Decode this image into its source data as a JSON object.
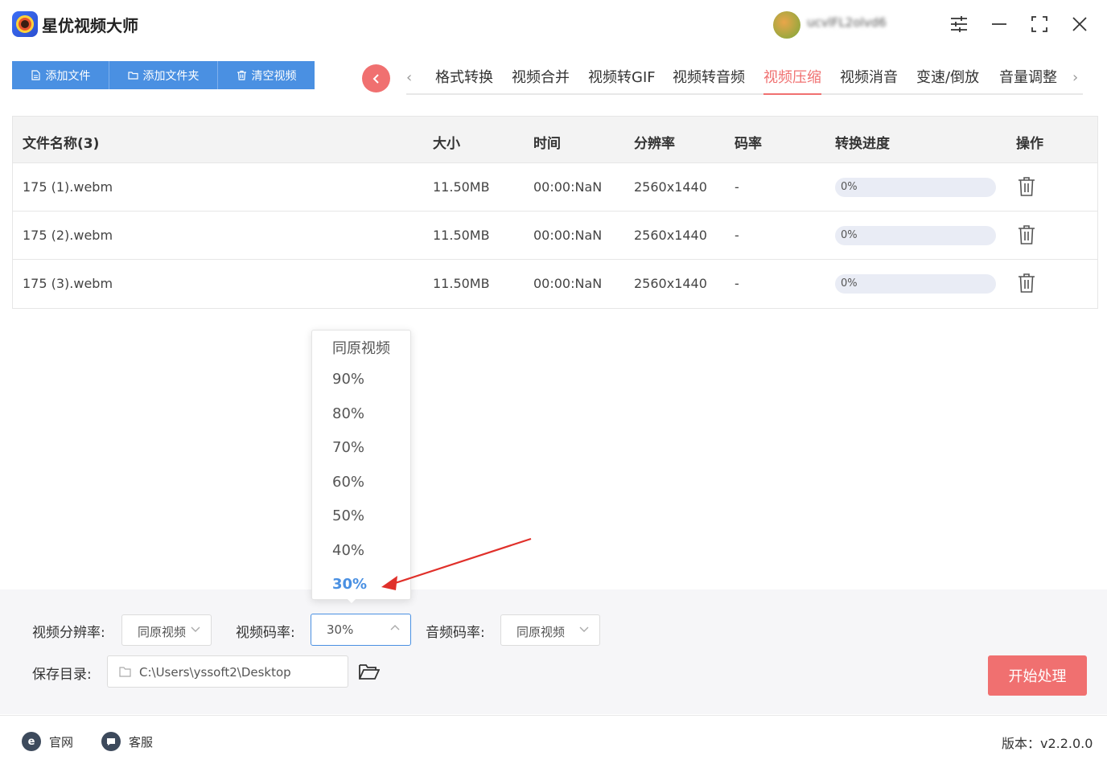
{
  "app": {
    "title": "星优视频大师"
  },
  "user": {
    "name": "ucvlFL2olvd6"
  },
  "toolbar": {
    "add_file": "添加文件",
    "add_folder": "添加文件夹",
    "clear": "清空视频"
  },
  "tabs": [
    "格式转换",
    "视频合并",
    "视频转GIF",
    "视频转音频",
    "视频压缩",
    "视频消音",
    "变速/倒放",
    "音量调整"
  ],
  "active_tab": "视频压缩",
  "table": {
    "headers": {
      "name": "文件名称(3)",
      "size": "大小",
      "time": "时间",
      "resolution": "分辨率",
      "bitrate": "码率",
      "progress": "转换进度",
      "action": "操作"
    },
    "rows": [
      {
        "name": "175 (1).webm",
        "size": "11.50MB",
        "time": "00:00:NaN",
        "resolution": "2560x1440",
        "bitrate": "-",
        "progress": "0%",
        "progress_value": 0
      },
      {
        "name": "175 (2).webm",
        "size": "11.50MB",
        "time": "00:00:NaN",
        "resolution": "2560x1440",
        "bitrate": "-",
        "progress": "0%",
        "progress_value": 0
      },
      {
        "name": "175 (3).webm",
        "size": "11.50MB",
        "time": "00:00:NaN",
        "resolution": "2560x1440",
        "bitrate": "-",
        "progress": "0%",
        "progress_value": 0
      }
    ]
  },
  "settings": {
    "resolution_label": "视频分辨率:",
    "resolution_value": "同原视频",
    "bitrate_label": "视频码率:",
    "bitrate_value": "30%",
    "audio_label": "音频码率:",
    "audio_value": "同原视频",
    "save_label": "保存目录:",
    "save_path": "C:\\Users\\yssoft2\\Desktop",
    "start_button": "开始处理"
  },
  "dropdown": {
    "options": [
      "同原视频",
      "90%",
      "80%",
      "70%",
      "60%",
      "50%",
      "40%",
      "30%"
    ],
    "selected": "30%"
  },
  "footer": {
    "website": "官网",
    "support": "客服",
    "version": "版本：v2.2.0.0"
  },
  "colors": {
    "accent_blue": "#4a90e2",
    "accent_red": "#f07070"
  }
}
